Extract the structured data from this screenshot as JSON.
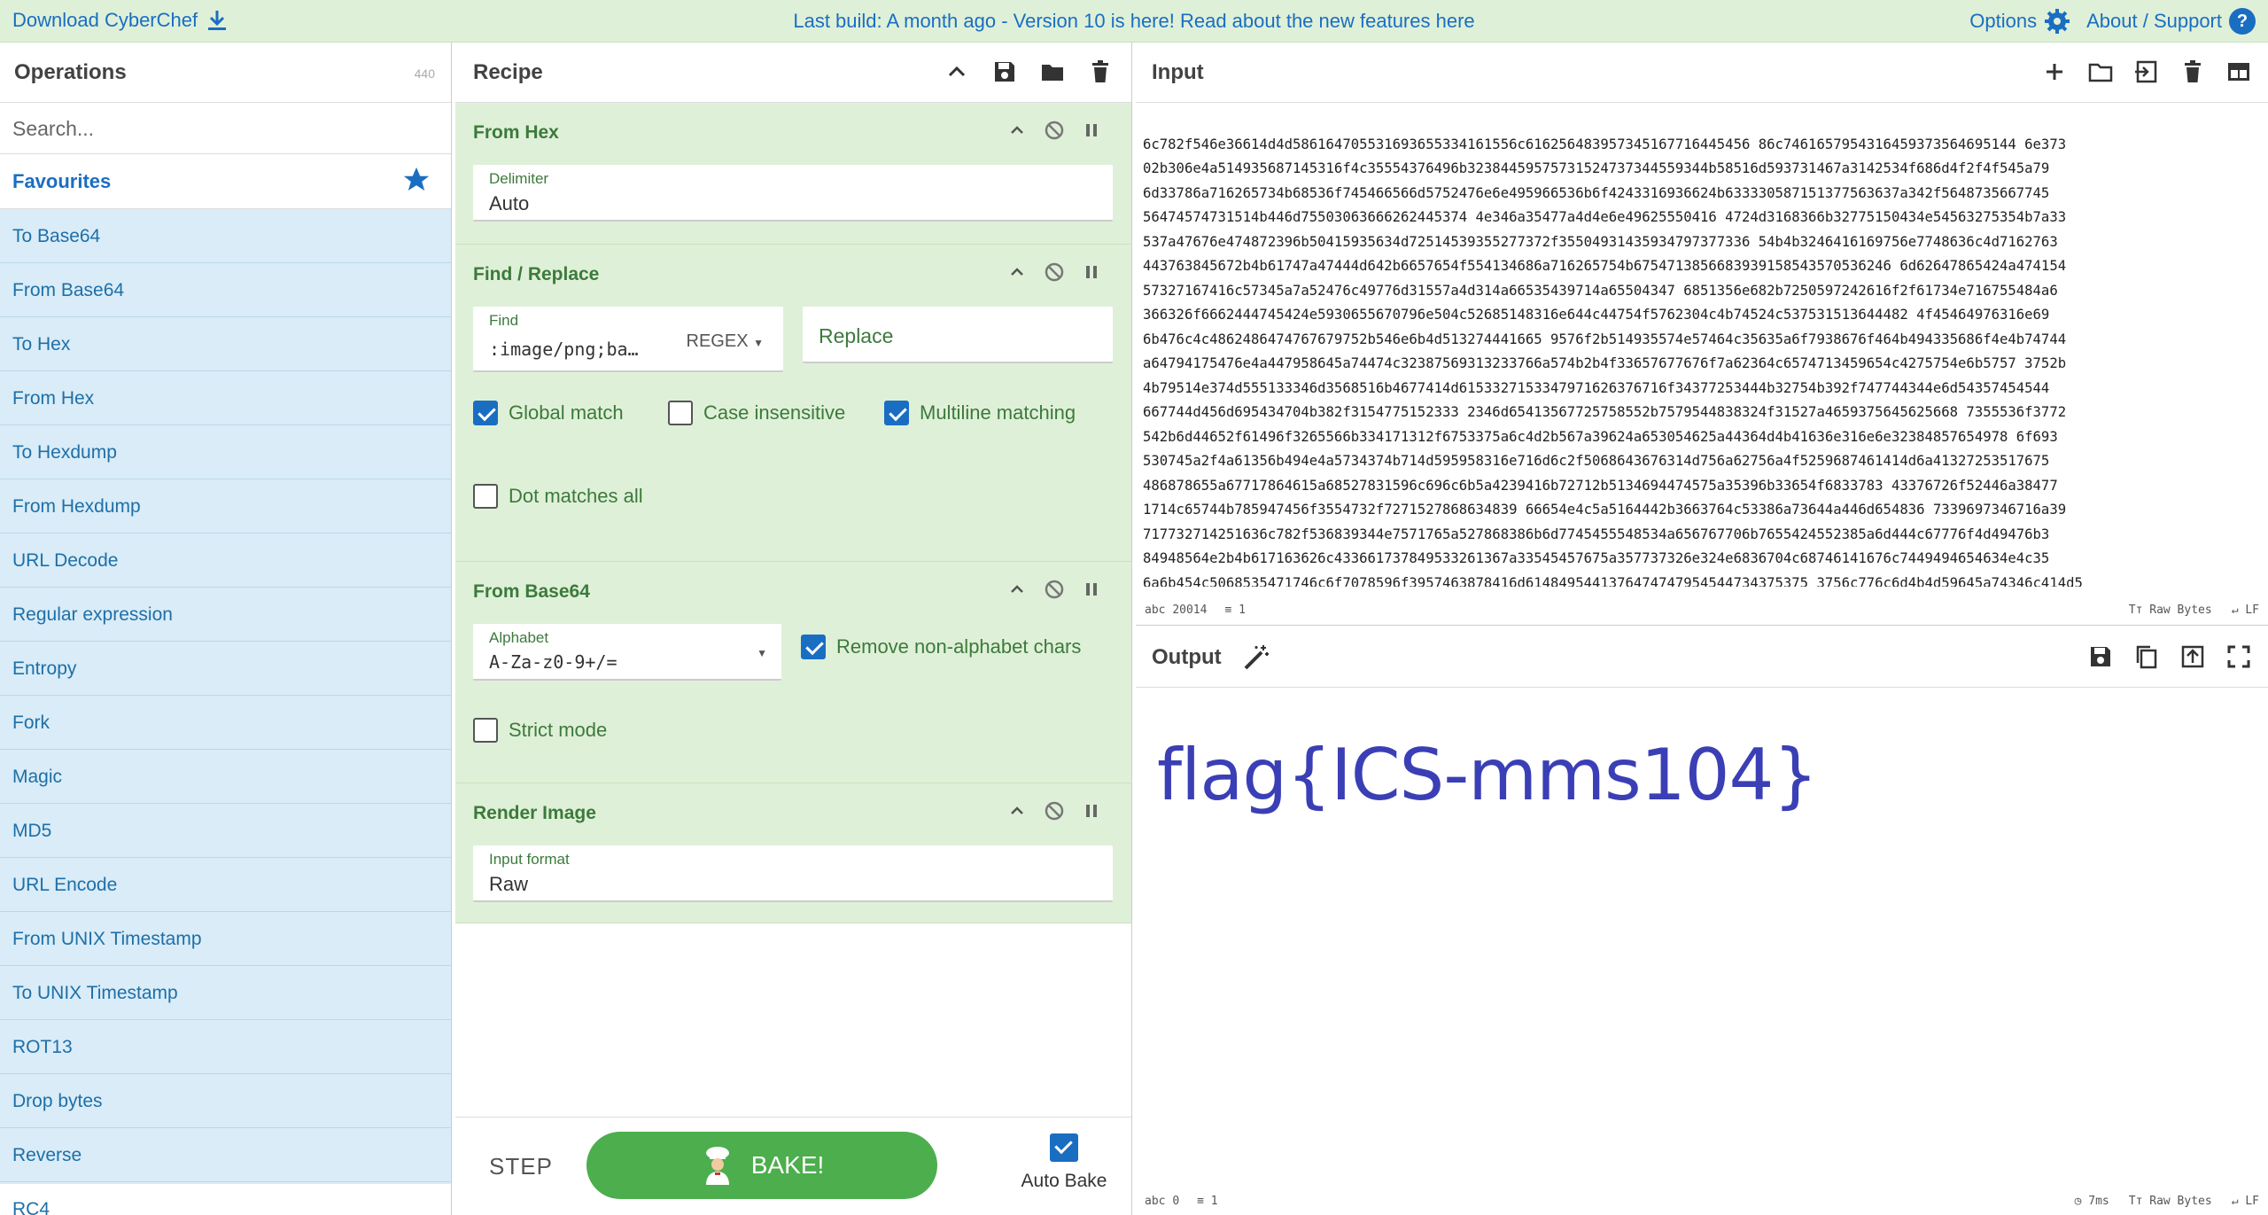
{
  "banner": {
    "download": "Download CyberChef",
    "notice": "Last build: A month ago - Version 10 is here! Read about the new features here",
    "options": "Options",
    "about": "About / Support"
  },
  "operations": {
    "title": "Operations",
    "count": "440",
    "search_placeholder": "Search...",
    "favourites": "Favourites",
    "items": [
      "To Base64",
      "From Base64",
      "To Hex",
      "From Hex",
      "To Hexdump",
      "From Hexdump",
      "URL Decode",
      "Regular expression",
      "Entropy",
      "Fork",
      "Magic",
      "MD5",
      "URL Encode",
      "From UNIX Timestamp",
      "To UNIX Timestamp",
      "ROT13",
      "Drop bytes",
      "Reverse",
      "RC4"
    ]
  },
  "recipe": {
    "title": "Recipe",
    "steps": {
      "from_hex": {
        "name": "From Hex",
        "delimiter_label": "Delimiter",
        "delimiter_value": "Auto"
      },
      "find_replace": {
        "name": "Find / Replace",
        "find_label": "Find",
        "find_value": ":image/png;ba…",
        "find_mode": "REGEX",
        "replace_placeholder": "Replace",
        "global_match": "Global match",
        "case_insensitive": "Case insensitive",
        "multiline": "Multiline matching",
        "dot_all": "Dot matches all"
      },
      "from_base64": {
        "name": "From Base64",
        "alphabet_label": "Alphabet",
        "alphabet_value": "A-Za-z0-9+/=",
        "remove_non_alpha": "Remove non-alphabet chars",
        "strict": "Strict mode"
      },
      "render_image": {
        "name": "Render Image",
        "format_label": "Input format",
        "format_value": "Raw"
      }
    },
    "step_label": "STEP",
    "bake_label": "BAKE!",
    "auto_bake": "Auto Bake"
  },
  "input": {
    "title": "Input",
    "lines": [
      "6c782f546e36614d4d586164705531693655334161556c616256483957345167716445456 86c7461657954316459373564695144 6e373",
      "02b306e4a514935687145316f4c35554376496b32384459575731524737344559344b58516d593731467a3142534f686d4f2f4f545a79",
      "6d33786a716265734b68536f745466566d5752476e6e495966536b6f4243316936624b633330587151377563637a342f5648735667745",
      "56474574731514b446d75503063666262445374 4e346a35477a4d4e6e49625550416 4724d3168366b32775150434e54563275354b7a33",
      "537a47676e474872396b50415935634d72514539355277372f35504931435934797377336 54b4b3246416169756e7748636c4d7162763",
      "443763845672b4b61747a47444d642b6657654f554134686a716265754b6754713856683939158543570536246 6d62647865424a474154",
      "57327167416c57345a7a52476c49776d31557a4d314a66535439714a65504347 6851356e682b7250597242616f2f61734e716755484a6",
      "366326f6662444745424e5930655670796e504c52685148316e644c44754f5762304c4b74524c537531513644482 4f45464976316e69",
      "6b476c4c4862486474767679752b546e6b4d513274441665 9576f2b514935574e57464c35635a6f7938676f464b494335686f4e4b74744",
      "a64794175476e4a447958645a74474c32387569313233766a574b2b4f33657677676f7a62364c6574713459654c4275754e6b5757 3752b",
      "4b79514e374d555133346d3568516b4677414d6153327153347971626376716f34377253444b32754b392f747744344e6d54357454544",
      "667744d456d695434704b382f3154775152333 2346d65413567725758552b7579544838324f31527a4659375645625668 7355536f3772",
      "542b6d44652f61496f3265566b334171312f6753375a6c4d2b567a39624a653054625a44364d4b41636e316e6e32384857654978 6f693",
      "530745a2f4a61356b494e4a5734374b714d595958316e716d6c2f5068643676314d756a62756a4f5259687461414d6a41327253517675",
      "486878655a67717864615a68527831596c696c6b5a4239416b72712b5134694474575a35396b33654f6833783 43376726f52446a38477",
      "1714c65744b785947456f3554732f7271527868634839 66654e4c5a5164442b3663764c53386a73644a446d654836 7339697346716a39",
      "717732714251636c782f536839344e7571765a527868386b6d7745455548534a656767706b7655424552385a6d444c67776f4d49476b3",
      "84948564e2b4b617163626c433661737849533261367a33545457675a357737326e324e6836704c68746141676c7449494654634e4c35",
      "6a6b454c5068535471746c6f7078596f3957463878416d6148495441376474747954544734375375 3756c776c6d4b4d59645a74346c414d5"
    ],
    "length_label": "abc",
    "length": "20014",
    "lines_label": "≡",
    "line_count": "1",
    "font_label": "Tт Raw Bytes",
    "eol_label": "↵ LF"
  },
  "output": {
    "title": "Output",
    "flag": "flag{ICS-mms104}",
    "length": "0",
    "line_count": "1",
    "time": "7ms",
    "font_label": "Tт Raw Bytes",
    "eol_label": "↵ LF"
  },
  "colors": {
    "banner_bg": "#dff0d8",
    "link": "#1a6ec2",
    "op_list_bg": "#d9ecf7",
    "recipe_step_bg": "#dff0d8",
    "bake_green": "#4cae4c",
    "flag_color": "#3b3fb5"
  }
}
